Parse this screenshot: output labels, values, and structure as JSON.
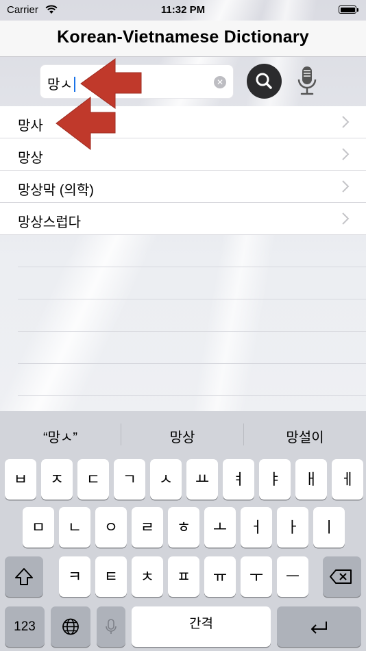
{
  "status": {
    "carrier": "Carrier",
    "time": "11:32 PM"
  },
  "nav": {
    "title": "Korean-Vietnamese Dictionary"
  },
  "search": {
    "query": "망ㅅ"
  },
  "results": [
    "망사",
    "망상",
    "망상막 (의학)",
    "망상스럽다"
  ],
  "keyboard": {
    "suggestions": [
      "“망ㅅ”",
      "망상",
      "망설이"
    ],
    "row1": [
      "ㅂ",
      "ㅈ",
      "ㄷ",
      "ㄱ",
      "ㅅ",
      "ㅛ",
      "ㅕ",
      "ㅑ",
      "ㅐ",
      "ㅔ"
    ],
    "row2": [
      "ㅁ",
      "ㄴ",
      "ㅇ",
      "ㄹ",
      "ㅎ",
      "ㅗ",
      "ㅓ",
      "ㅏ",
      "ㅣ"
    ],
    "row3": [
      "ㅋ",
      "ㅌ",
      "ㅊ",
      "ㅍ",
      "ㅠ",
      "ㅜ",
      "ㅡ"
    ],
    "numbers_label": "123",
    "space_label": "간격"
  },
  "colors": {
    "arrow": "#c0392b",
    "search_button": "#2b2b2d",
    "caret": "#1a73e8"
  },
  "icons": [
    "wifi-icon",
    "battery-icon",
    "clear-icon",
    "search-icon",
    "mic-icon",
    "chevron-right-icon",
    "shift-icon",
    "backspace-icon",
    "globe-icon",
    "keyboard-mic-icon",
    "return-icon",
    "red-arrow-icon"
  ]
}
